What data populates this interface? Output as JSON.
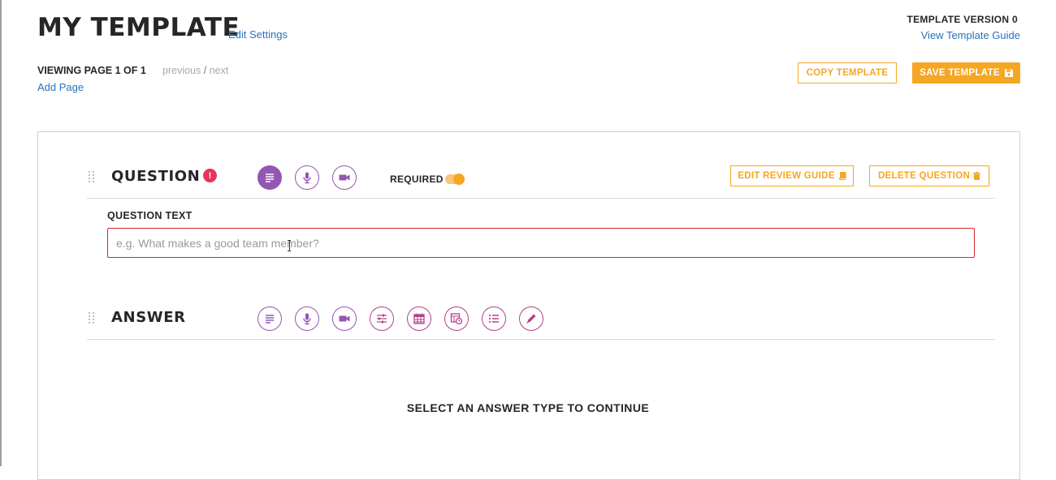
{
  "header": {
    "title": "MY TEMPLATE",
    "edit_settings": "Edit Settings",
    "version_label": "TEMPLATE VERSION 0",
    "guide_link": "View Template Guide"
  },
  "pagination": {
    "viewing": "VIEWING PAGE 1 OF 1",
    "previous": "previous",
    "separator": "/",
    "next": "next",
    "add_page": "Add Page"
  },
  "actions": {
    "copy": "COPY TEMPLATE",
    "save": "SAVE TEMPLATE"
  },
  "question": {
    "title": "QUESTION",
    "alert_glyph": "!",
    "types": [
      "text-icon",
      "microphone-icon",
      "video-icon"
    ],
    "required_label": "REQUIRED",
    "required_on": true,
    "edit_review_guide": "EDIT REVIEW GUIDE",
    "delete_question": "DELETE QUESTION",
    "text_label": "QUESTION TEXT",
    "text_placeholder": "e.g. What makes a good team member?",
    "text_value": ""
  },
  "answer": {
    "title": "ANSWER",
    "types": [
      "text-icon",
      "microphone-icon",
      "video-icon",
      "sliders-icon",
      "calendar-icon",
      "schedule-icon",
      "list-icon",
      "pen-icon"
    ],
    "prompt": "SELECT AN ANSWER TYPE TO CONTINUE"
  },
  "colors": {
    "accent": "#f5a623",
    "purple": "#9456b3",
    "pink": "#b4418e",
    "error": "#d9252e",
    "link": "#2a73b8"
  }
}
